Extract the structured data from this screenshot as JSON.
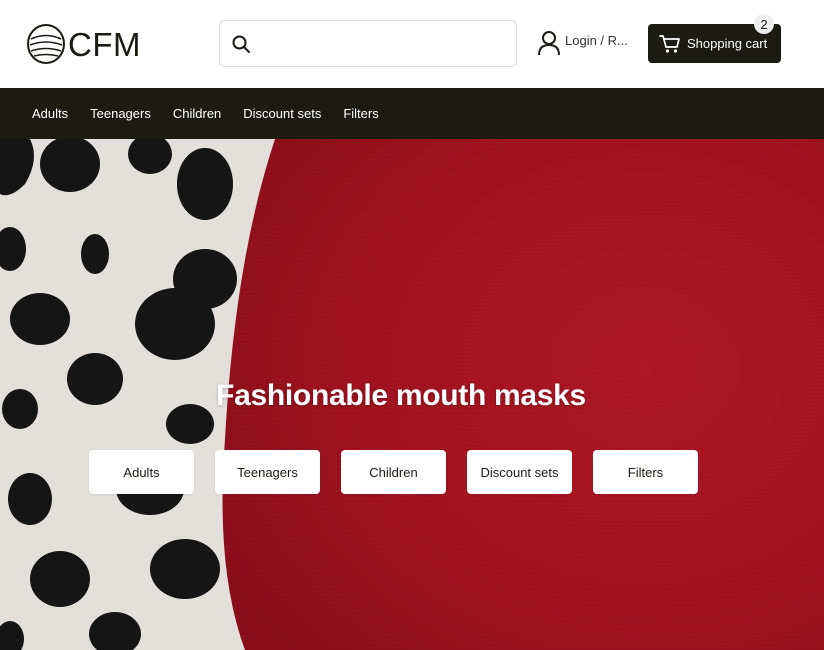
{
  "header": {
    "logo_text": "CFM",
    "search": {
      "placeholder": "",
      "value": ""
    },
    "login_label": "Login / R...",
    "cart": {
      "label": "Shopping cart",
      "count": "2"
    }
  },
  "nav": {
    "items": [
      {
        "label": "Adults"
      },
      {
        "label": "Teenagers"
      },
      {
        "label": "Children"
      },
      {
        "label": "Discount sets"
      },
      {
        "label": "Filters"
      }
    ]
  },
  "hero": {
    "title": "Fashionable mouth masks",
    "buttons": [
      {
        "label": "Adults"
      },
      {
        "label": "Teenagers"
      },
      {
        "label": "Children"
      },
      {
        "label": "Discount sets"
      },
      {
        "label": "Filters"
      }
    ]
  },
  "colors": {
    "dark": "#1b1b14",
    "navbar": "#1b1b0f",
    "fabric_red": "#a3121f",
    "fabric_light": "#e4e1dd"
  },
  "icons": {
    "logo": "mask-logo-icon",
    "search": "search-icon",
    "login": "user-icon",
    "cart": "cart-icon"
  }
}
